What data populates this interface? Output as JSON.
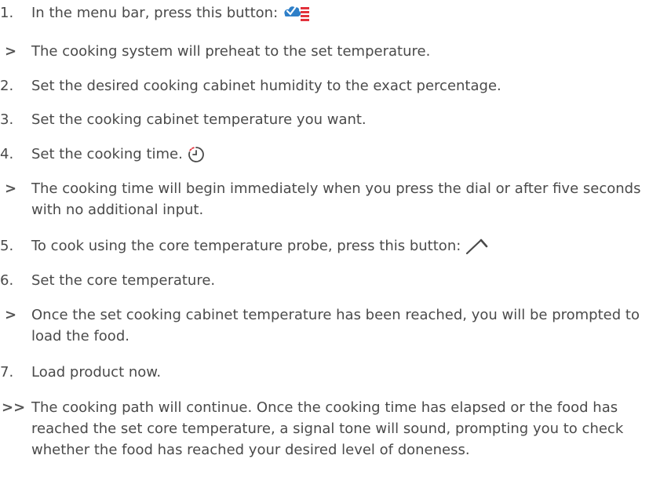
{
  "steps": [
    {
      "marker": "1.",
      "text": "In the menu bar, press this button:",
      "icon": "humidity-steam-icon"
    },
    {
      "marker": ">",
      "text": "The cooking system will preheat to the set temperature."
    },
    {
      "marker": "2.",
      "text": "Set the desired cooking cabinet humidity to the exact percentage."
    },
    {
      "marker": "3.",
      "text": "Set the cooking cabinet temperature you want."
    },
    {
      "marker": "4.",
      "text": "Set the cooking time.",
      "icon": "timer-icon"
    },
    {
      "marker": ">",
      "text": "The cooking time will begin immediately when you press the dial or after five seconds with no additional input."
    },
    {
      "marker": "5.",
      "text": "To cook using the core temperature probe, press this button:",
      "icon": "core-probe-icon"
    },
    {
      "marker": "6.",
      "text": "Set the core temperature."
    },
    {
      "marker": ">",
      "text": "Once the set cooking cabinet temperature has been reached, you will be prompted to load the food."
    },
    {
      "marker": "7.",
      "text": "Load product now."
    },
    {
      "marker": ">>",
      "text": "The cooking path will continue. Once the cooking time has elapsed or the food has reached the set core temperature, a signal tone will sound, prompting you to check whether the food has reached your desired level of doneness."
    }
  ],
  "colors": {
    "text": "#4a4a4a",
    "accent_blue": "#2e7fc8",
    "accent_red": "#e2323c"
  }
}
